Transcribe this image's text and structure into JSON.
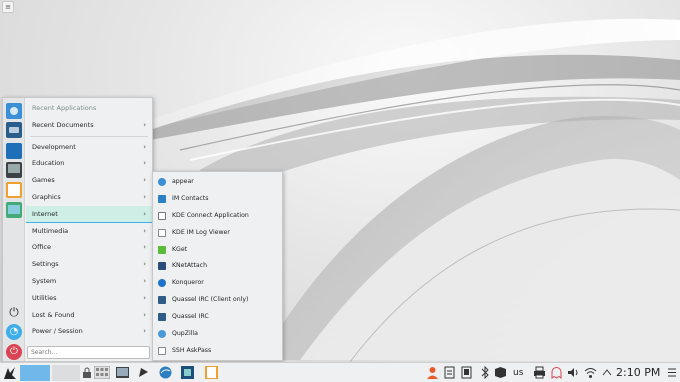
{
  "desktop": {
    "toolbox_icon": "hamburger-icon"
  },
  "launcher": {
    "favorites": [
      {
        "name": "browser-icon"
      },
      {
        "name": "kdeconnect-icon"
      },
      {
        "name": "file-manager-icon"
      },
      {
        "name": "terminal-icon"
      },
      {
        "name": "kwrite-icon"
      },
      {
        "name": "image-viewer-icon"
      }
    ],
    "session_icons": [
      "power-icon",
      "lock-icon",
      "shutdown-icon"
    ],
    "items": [
      {
        "label": "Recent Applications",
        "header": true
      },
      {
        "label": "Recent Documents",
        "arrow": "›"
      },
      {
        "label": "Development",
        "arrow": "›"
      },
      {
        "label": "Education",
        "arrow": "›"
      },
      {
        "label": "Games",
        "arrow": "›"
      },
      {
        "label": "Graphics",
        "arrow": "›"
      },
      {
        "label": "Internet",
        "arrow": "›",
        "active": true
      },
      {
        "label": "Multimedia",
        "arrow": "›"
      },
      {
        "label": "Office",
        "arrow": "›"
      },
      {
        "label": "Settings",
        "arrow": "›"
      },
      {
        "label": "System",
        "arrow": "›"
      },
      {
        "label": "Utilities",
        "arrow": "›"
      },
      {
        "label": "Lost & Found",
        "arrow": "›"
      },
      {
        "label": "Power / Session",
        "arrow": "›"
      }
    ],
    "search_placeholder": "Search..."
  },
  "submenu": {
    "items": [
      {
        "label": "appear",
        "icon": "globe-icon"
      },
      {
        "label": "IM Contacts",
        "icon": "contacts-icon"
      },
      {
        "label": "KDE Connect Application",
        "icon": "kdeconnect-icon"
      },
      {
        "label": "KDE IM Log Viewer",
        "icon": "log-viewer-icon"
      },
      {
        "label": "KGet",
        "icon": "kget-icon"
      },
      {
        "label": "KNetAttach",
        "icon": "knetattach-icon"
      },
      {
        "label": "Konqueror",
        "icon": "konqueror-icon"
      },
      {
        "label": "Quassel IRC (Client only)",
        "icon": "quassel-icon"
      },
      {
        "label": "Quassel IRC",
        "icon": "quassel-icon"
      },
      {
        "label": "QupZilla",
        "icon": "qupzilla-icon"
      },
      {
        "label": "SSH AskPass",
        "icon": "ssh-askpass-icon"
      }
    ]
  },
  "taskbar": {
    "keyboard_layout": "us",
    "clock": "2:10 PM",
    "accent": "#3daee9"
  }
}
